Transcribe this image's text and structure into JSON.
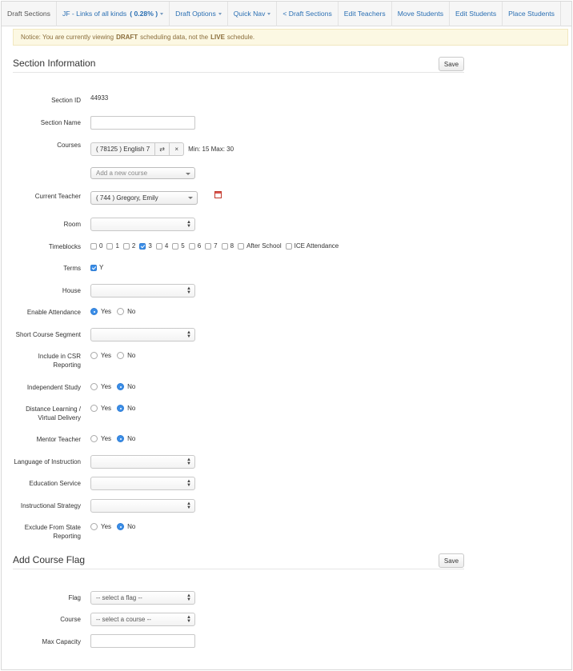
{
  "nav": {
    "brand": "Draft Sections",
    "draft_name": "JF - Links of all kinds",
    "draft_pct": "( 0.28% )",
    "draft_options": "Draft Options",
    "quick_nav": "Quick Nav",
    "back": "< Draft Sections",
    "edit_teachers": "Edit Teachers",
    "move_students": "Move Students",
    "edit_students": "Edit Students",
    "place_students": "Place Students"
  },
  "notice": {
    "prefix": "Notice: You are currently viewing",
    "draft": "DRAFT",
    "middle": "scheduling data, not the",
    "live": "LIVE",
    "suffix": "schedule."
  },
  "section_info": {
    "title": "Section Information",
    "save": "Save",
    "labels": {
      "section_id": "Section ID",
      "section_name": "Section Name",
      "courses": "Courses",
      "current_teacher": "Current Teacher",
      "room": "Room",
      "timeblocks": "Timeblocks",
      "terms": "Terms",
      "house": "House",
      "enable_attendance": "Enable Attendance",
      "short_course_segment": "Short Course Segment",
      "include_csr": "Include in CSR Reporting",
      "independent_study": "Independent Study",
      "distance_learning": "Distance Learning / Virtual Delivery",
      "mentor_teacher": "Mentor Teacher",
      "language_of_instruction": "Language of Instruction",
      "education_service": "Education Service",
      "instructional_strategy": "Instructional Strategy",
      "exclude_state": "Exclude From State Reporting"
    },
    "section_id_value": "44933",
    "section_name_value": "",
    "course_tag": "( 78125 ) English 7",
    "swap_glyph": "⇄",
    "remove_glyph": "×",
    "min_max": "Min: 15 Max: 30",
    "add_course_placeholder": "Add a new course",
    "teacher_value": "( 744 ) Gregory, Emily",
    "timeblocks": [
      {
        "label": "0",
        "checked": false
      },
      {
        "label": "1",
        "checked": false
      },
      {
        "label": "2",
        "checked": false
      },
      {
        "label": "3",
        "checked": true
      },
      {
        "label": "4",
        "checked": false
      },
      {
        "label": "5",
        "checked": false
      },
      {
        "label": "6",
        "checked": false
      },
      {
        "label": "7",
        "checked": false
      },
      {
        "label": "8",
        "checked": false
      },
      {
        "label": "After School",
        "checked": false
      },
      {
        "label": "ICE Attendance",
        "checked": false
      }
    ],
    "terms_label_value": "Y",
    "yes": "Yes",
    "no": "No",
    "radios": {
      "enable_attendance": "yes",
      "include_csr": "none",
      "independent_study": "no",
      "distance_learning": "no",
      "mentor_teacher": "no",
      "exclude_state": "no"
    }
  },
  "course_flag": {
    "title": "Add Course Flag",
    "save": "Save",
    "labels": {
      "flag": "Flag",
      "course": "Course",
      "max_capacity": "Max Capacity"
    },
    "flag_select": "-- select a flag --",
    "course_select": "-- select a course --",
    "max_capacity_value": ""
  }
}
